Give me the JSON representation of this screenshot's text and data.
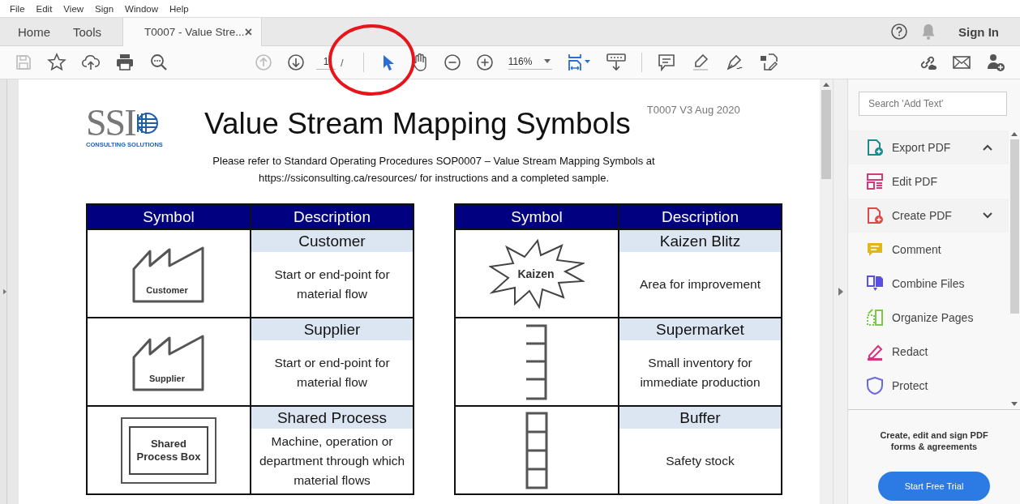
{
  "menu": [
    "File",
    "Edit",
    "View",
    "Sign",
    "Window",
    "Help"
  ],
  "tabs": [
    {
      "label": "Home",
      "selected": false
    },
    {
      "label": "Tools",
      "selected": false
    },
    {
      "label": "T0007 - Value Stre...",
      "selected": true,
      "close": "×"
    }
  ],
  "account": {
    "sign_in": "Sign In"
  },
  "toolbar": {
    "page": "1",
    "page_separator": "/",
    "zoom": "116%",
    "tools": [
      {
        "kind": "select",
        "selected": true
      },
      {
        "kind": "hand",
        "selected": false
      }
    ]
  },
  "document": {
    "logo_text": "SSI",
    "logo_subtitle": "CONSULTING SOLUTIONS",
    "title": "Value Stream Mapping Symbols",
    "version": "T0007 V3 Aug 2020",
    "intro": [
      "Please refer to Standard Operating Procedures SOP0007 – Value Stream Mapping Symbols at",
      "https://ssiconsulting.ca/resources/ for instructions and a completed sample."
    ],
    "tables": [
      {
        "columns": [
          "Symbol",
          "Description"
        ],
        "rows": [
          {
            "kind": "factory",
            "symbol_label": "Customer",
            "name": "Customer",
            "description": "Start or end-point for material flow"
          },
          {
            "kind": "factory",
            "symbol_label": "Supplier",
            "name": "Supplier",
            "description": "Start or end-point for material flow"
          },
          {
            "kind": "process",
            "symbol_label": "Shared Process Box",
            "name": "Shared Process",
            "description": "Machine, operation or department through which material flows"
          }
        ]
      },
      {
        "columns": [
          "Symbol",
          "Description"
        ],
        "rows": [
          {
            "kind": "kaizen",
            "symbol_label": "Kaizen",
            "name": "Kaizen Blitz",
            "description": "Area for improvement"
          },
          {
            "kind": "supermarket",
            "name": "Supermarket",
            "description": "Small inventory for immediate production"
          },
          {
            "kind": "buffer",
            "name": "Buffer",
            "description": "Safety stock"
          }
        ]
      }
    ]
  },
  "tools_panel": {
    "search_placeholder": "Search 'Add Text'",
    "items": [
      {
        "kind": "export",
        "label": "Export PDF",
        "color": "#1a8c8c",
        "expanded": true
      },
      {
        "kind": "edit",
        "label": "Edit PDF",
        "color": "#d8377a"
      },
      {
        "kind": "create",
        "label": "Create PDF",
        "color": "#e04848",
        "expanded": false
      },
      {
        "kind": "comment",
        "label": "Comment",
        "color": "#e0b81e"
      },
      {
        "kind": "combine",
        "label": "Combine Files",
        "color": "#5a4fe0"
      },
      {
        "kind": "organize",
        "label": "Organize Pages",
        "color": "#7cc844"
      },
      {
        "kind": "redact",
        "label": "Redact",
        "color": "#d8337e"
      },
      {
        "kind": "protect",
        "label": "Protect",
        "color": "#6a6ae0"
      }
    ],
    "promo": "Create, edit and sign PDF forms & agreements",
    "cta": "Start Free Trial"
  }
}
